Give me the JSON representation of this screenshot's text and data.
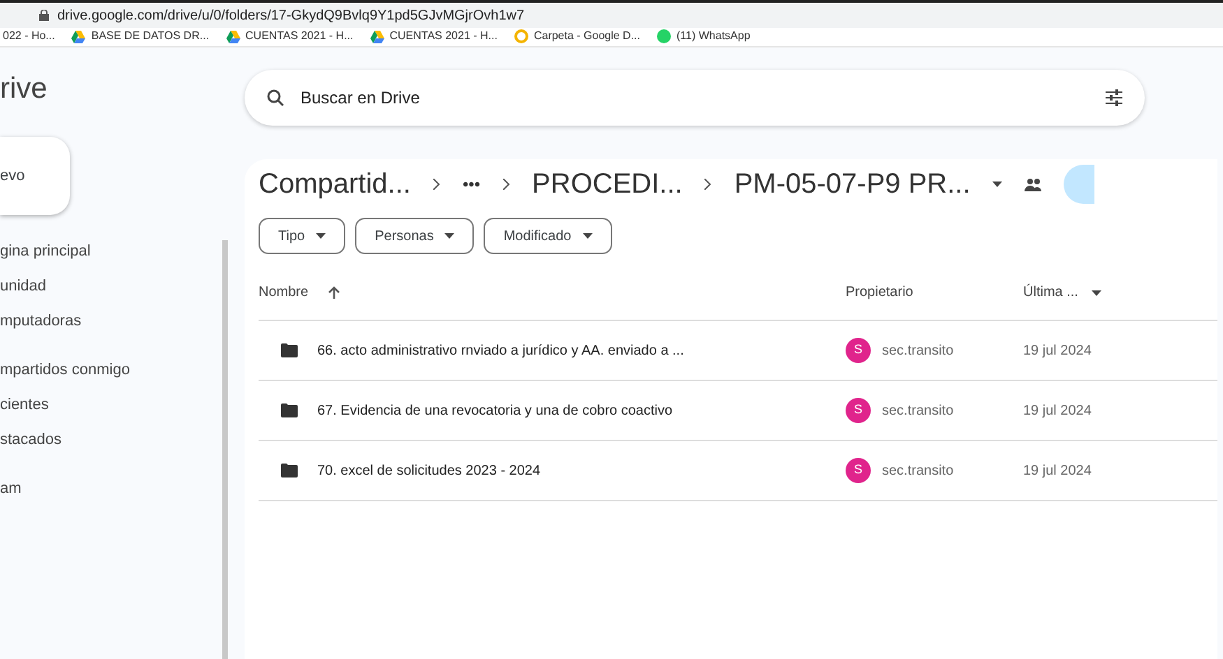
{
  "address_bar": {
    "url": "drive.google.com/drive/u/0/folders/17-GkydQ9Bvlq9Y1pd5GJvMGjrOvh1w7"
  },
  "bookmarks": [
    {
      "label": "022 - Ho...",
      "kind": "none"
    },
    {
      "label": "BASE DE DATOS DR...",
      "kind": "drive"
    },
    {
      "label": "CUENTAS 2021 - H...",
      "kind": "drive"
    },
    {
      "label": "CUENTAS 2021 - H...",
      "kind": "drive"
    },
    {
      "label": "Carpeta - Google D...",
      "kind": "gdoc"
    },
    {
      "label": "(11) WhatsApp",
      "kind": "whatsapp"
    }
  ],
  "app_title": "rive",
  "new_button": "evo",
  "sidebar": {
    "groups": [
      [
        "gina principal",
        "unidad",
        "mputadoras"
      ],
      [
        "mpartidos conmigo",
        "cientes",
        "stacados"
      ],
      [
        "am"
      ]
    ]
  },
  "search": {
    "placeholder": "Buscar en Drive"
  },
  "breadcrumb": [
    "Compartid...",
    "•••",
    "PROCEDI...",
    "PM-05-07-P9 PR..."
  ],
  "filters": [
    "Tipo",
    "Personas",
    "Modificado"
  ],
  "table": {
    "columns": [
      "Nombre",
      "Propietario",
      "Última ..."
    ],
    "rows": [
      {
        "name": "66. acto administrativo rnviado a jurídico y AA. enviado a ...",
        "owner_initial": "S",
        "owner": "sec.transito",
        "color": "#e0248c",
        "date": "19 jul 2024"
      },
      {
        "name": "67. Evidencia de una revocatoria y una de cobro coactivo",
        "owner_initial": "S",
        "owner": "sec.transito",
        "color": "#e0248c",
        "date": "19 jul 2024"
      },
      {
        "name": "70. excel de solicitudes 2023 - 2024",
        "owner_initial": "S",
        "owner": "sec.transito",
        "color": "#e0248c",
        "date": "19 jul 2024"
      }
    ]
  }
}
